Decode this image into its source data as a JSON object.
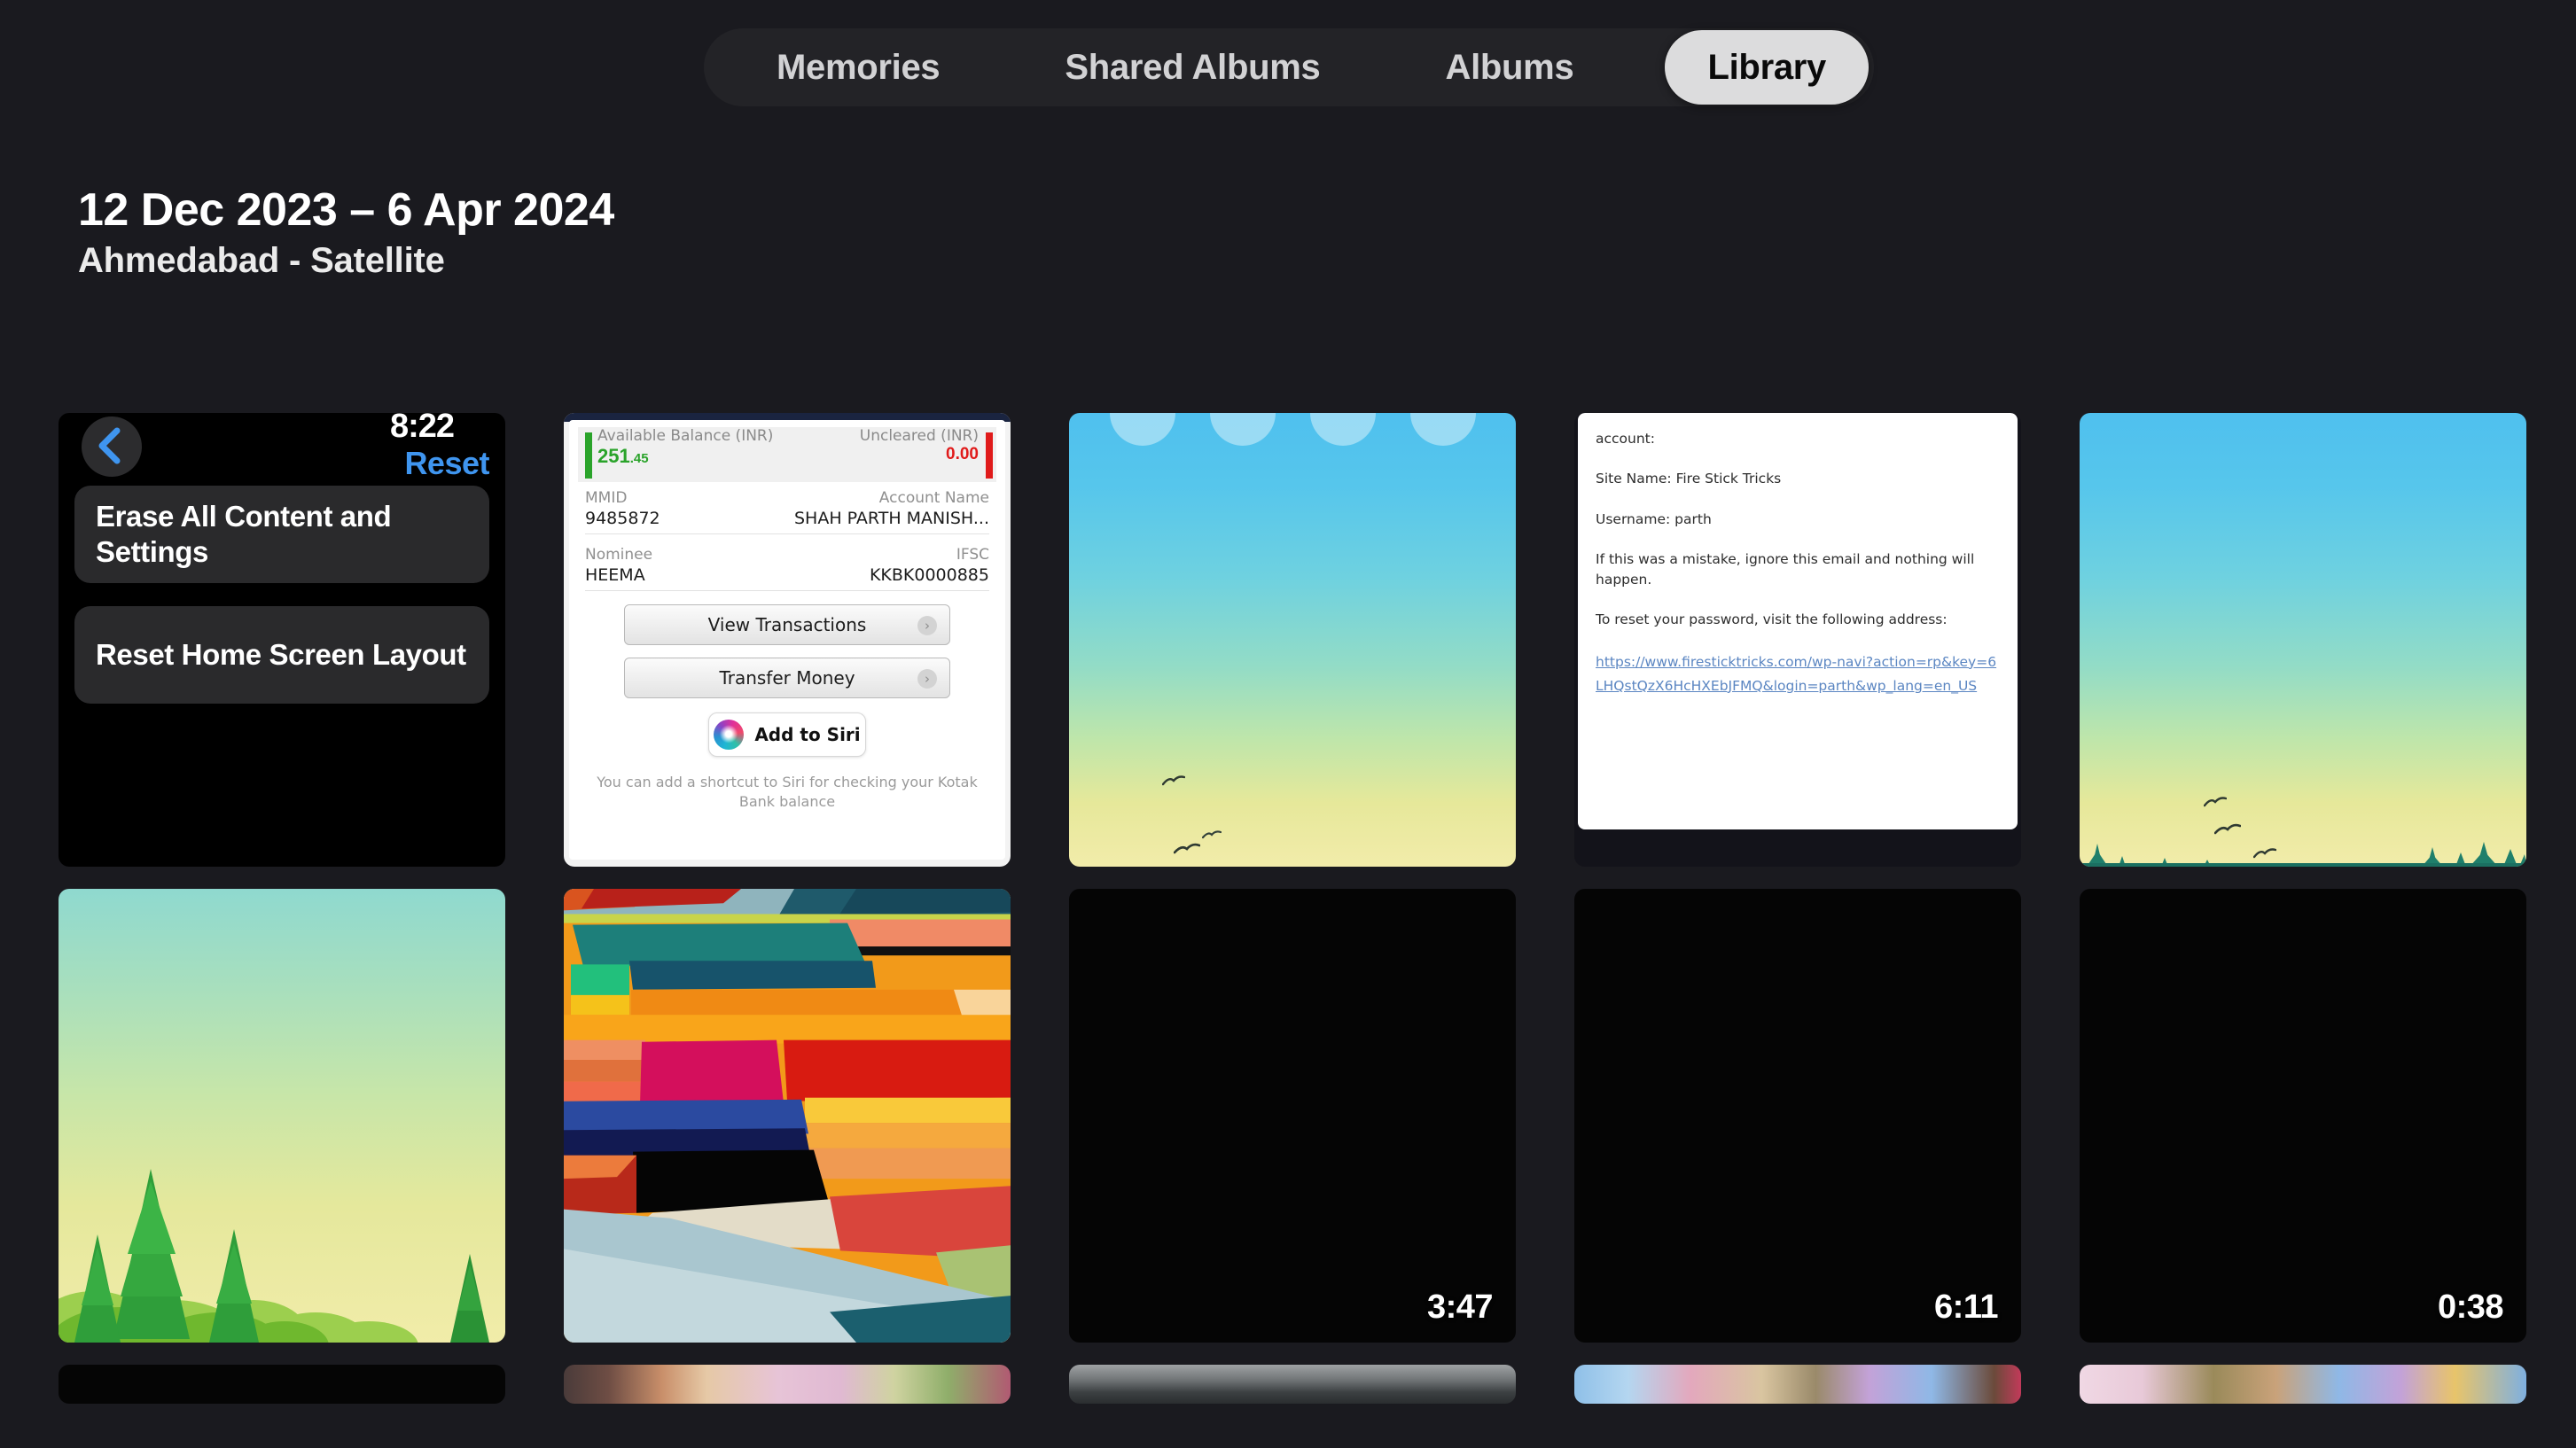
{
  "tabbar": {
    "tabs": [
      {
        "label": "Memories",
        "active": false
      },
      {
        "label": "Shared Albums",
        "active": false
      },
      {
        "label": "Albums",
        "active": false
      },
      {
        "label": "Library",
        "active": true
      }
    ]
  },
  "header": {
    "date_range": "12 Dec 2023 – 6 Apr 2024",
    "location": "Ahmedabad - Satellite"
  },
  "colors": {
    "background": "#1a1a1f",
    "tabbar_background": "#232327",
    "active_tab_background": "#dcdcdd",
    "active_tab_text": "#0a0a0a",
    "inactive_tab_text": "#d2d2d4",
    "ios_link_blue": "#3f95ef",
    "balance_green": "#2aa32a",
    "uncleared_red": "#e01b1b"
  },
  "grid": {
    "row1": [
      {
        "type": "ios-settings-screenshot",
        "name": "reset-settings-screenshot",
        "status_time": "8:22",
        "nav_title": "Reset",
        "back_icon": "chevron-left-icon",
        "rows": [
          "Erase All Content and Settings",
          "Reset Home Screen Layout"
        ]
      },
      {
        "type": "bank-app-screenshot",
        "name": "kotak-bank-screenshot",
        "balance_label": "Available Balance (INR)",
        "balance_value_int": "251",
        "balance_value_dec": ".45",
        "uncleared_label": "Uncleared (INR)",
        "uncleared_value": "0.00",
        "fields": [
          {
            "label": "MMID",
            "value": "9485872",
            "label_right": "Account Name",
            "value_right": "SHAH PARTH MANISH..."
          },
          {
            "label": "Nominee",
            "value": "HEEMA",
            "label_right": "IFSC",
            "value_right": "KKBK0000885"
          }
        ],
        "buttons": [
          {
            "label": "View Transactions",
            "chevron": "chevron-right-icon"
          },
          {
            "label": "Transfer Money",
            "chevron": "chevron-right-icon"
          }
        ],
        "siri_button_label": "Add to Siri",
        "siri_icon": "siri-orb-icon",
        "hint": "You can add a shortcut to Siri for checking your Kotak Bank balance"
      },
      {
        "type": "sky-photo",
        "name": "sky-with-app-icons-photo",
        "icons": [
          "app-icon",
          "app-icon",
          "app-icon",
          "app-icon"
        ],
        "birds": 3
      },
      {
        "type": "email-screenshot",
        "name": "password-reset-email-screenshot",
        "lines": [
          "account:",
          "Site Name: Fire Stick Tricks",
          "Username: parth",
          "If this was a mistake, ignore this email and nothing will happen.",
          "To reset your password, visit the following address:"
        ],
        "link": "https://www.firesticktricks.com/wp-navi?action=rp&key=6LHQstQzX6HcHXEbJFMQ&login=parth&wp_lang=en_US"
      },
      {
        "type": "sky-photo",
        "name": "sky-with-treeline-photo",
        "birds": 3,
        "has_treeline": true
      }
    ],
    "row2": [
      {
        "type": "sky-photo",
        "name": "forest-sunset-photo",
        "has_big_trees": true
      },
      {
        "type": "abstract-photo",
        "name": "abstract-geometric-artwork"
      },
      {
        "type": "video",
        "name": "video-thumbnail",
        "duration": "3:47"
      },
      {
        "type": "video",
        "name": "video-thumbnail",
        "duration": "6:11"
      },
      {
        "type": "video",
        "name": "video-thumbnail",
        "duration": "0:38"
      }
    ],
    "row3": [
      {
        "type": "partial",
        "name": "partial-thumbnail-dark",
        "style": "s-black"
      },
      {
        "type": "partial",
        "name": "partial-thumbnail-food",
        "style": "s-food"
      },
      {
        "type": "partial",
        "name": "partial-thumbnail-road",
        "style": "s-road"
      },
      {
        "type": "partial",
        "name": "partial-thumbnail-flowers",
        "style": "s-flowers"
      },
      {
        "type": "partial",
        "name": "partial-thumbnail-flowers-2",
        "style": "s-flowers2"
      }
    ]
  }
}
